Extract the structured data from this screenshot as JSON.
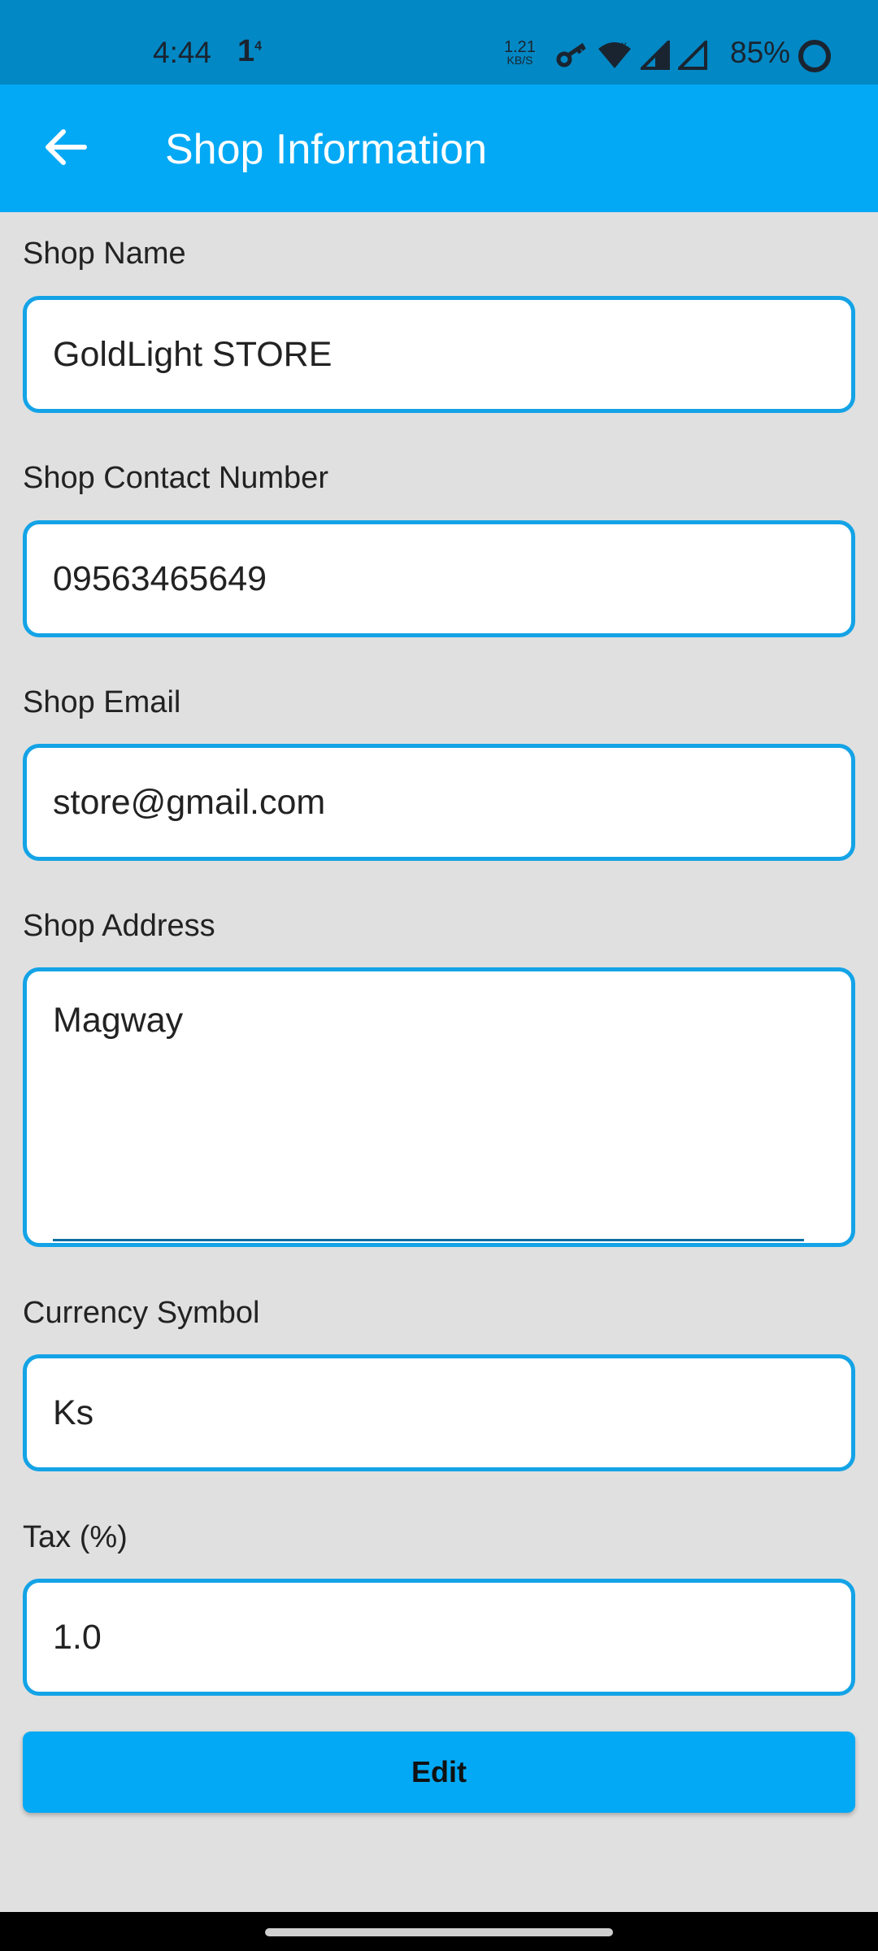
{
  "status_bar": {
    "time": "4:44",
    "notification": "1",
    "notification_sup": "4",
    "net_speed": "1.21",
    "net_unit": "KB/S",
    "battery": "85%",
    "icons": [
      "key-icon",
      "wifi-icon",
      "signal-icon",
      "signal-icon"
    ]
  },
  "app_bar": {
    "title": "Shop Information",
    "back_icon": "arrow-left-icon"
  },
  "form": {
    "shop_name": {
      "label": "Shop Name",
      "value": "GoldLight STORE"
    },
    "contact": {
      "label": "Shop Contact Number",
      "value": "09563465649"
    },
    "email": {
      "label": "Shop Email",
      "value": "store@gmail.com"
    },
    "address": {
      "label": "Shop Address",
      "value": "Magway"
    },
    "currency": {
      "label": "Currency Symbol",
      "value": "Ks"
    },
    "tax": {
      "label": "Tax (%)",
      "value": "1.0"
    }
  },
  "edit_button": "Edit",
  "colors": {
    "app_bar": "#03a9f4",
    "status_bar": "#0288c4",
    "border": "#14a3e6",
    "background": "#e0e0e0"
  }
}
